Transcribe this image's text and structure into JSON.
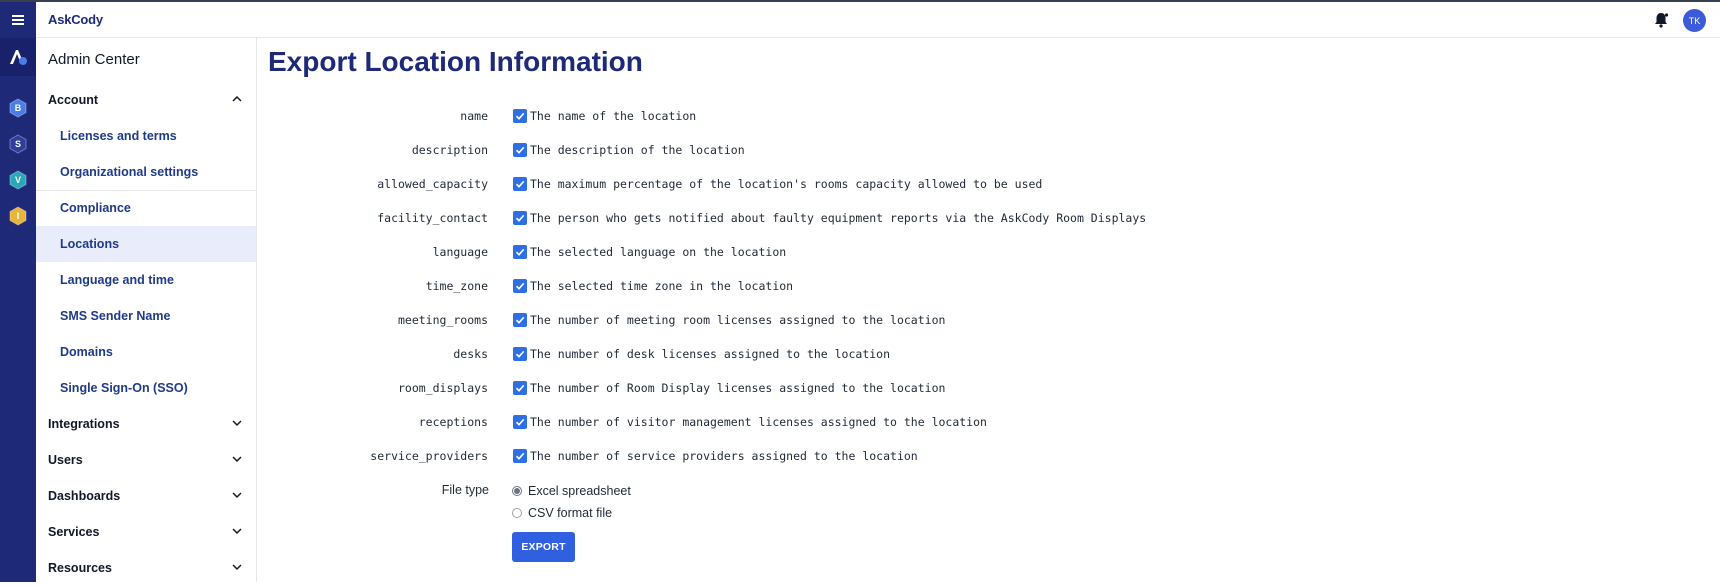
{
  "header": {
    "brand": "AskCody",
    "avatar_initials": "TK",
    "accent": "#1e2a78",
    "button_color": "#3060e0"
  },
  "rail": {
    "icons": [
      {
        "letter": "B",
        "color": "#4a7de8"
      },
      {
        "letter": "S",
        "color": "#2e3e9a"
      },
      {
        "letter": "V",
        "color": "#2aa7b8"
      },
      {
        "letter": "I",
        "color": "#e8b53a"
      }
    ]
  },
  "sidebar": {
    "title": "Admin Center",
    "account": {
      "label": "Account",
      "expanded": true
    },
    "account_items": [
      "Licenses and terms",
      "Organizational settings",
      "Compliance",
      "Locations",
      "Language and time",
      "SMS Sender Name",
      "Domains",
      "Single Sign-On (SSO)"
    ],
    "active_item": "Locations",
    "groups": [
      "Integrations",
      "Users",
      "Dashboards",
      "Services",
      "Resources"
    ]
  },
  "main": {
    "title": "Export Location Information",
    "fields": [
      {
        "name": "name",
        "description": "The name of the location",
        "checked": true
      },
      {
        "name": "description",
        "description": "The description of the location",
        "checked": true
      },
      {
        "name": "allowed_capacity",
        "description": "The maximum percentage of the location's rooms capacity allowed to be used",
        "checked": true
      },
      {
        "name": "facility_contact",
        "description": "The person who gets notified about faulty equipment reports via the AskCody Room Displays",
        "checked": true
      },
      {
        "name": "language",
        "description": "The selected language on the location",
        "checked": true
      },
      {
        "name": "time_zone",
        "description": "The selected time zone in the location",
        "checked": true
      },
      {
        "name": "meeting_rooms",
        "description": "The number of meeting room licenses assigned to the location",
        "checked": true
      },
      {
        "name": "desks",
        "description": "The number of desk licenses assigned to the location",
        "checked": true
      },
      {
        "name": "room_displays",
        "description": "The number of Room Display licenses assigned to the location",
        "checked": true
      },
      {
        "name": "receptions",
        "description": "The number of visitor management licenses assigned to the location",
        "checked": true
      },
      {
        "name": "service_providers",
        "description": "The number of service providers assigned to the location",
        "checked": true
      }
    ],
    "file_type": {
      "label": "File type",
      "options": [
        "Excel spreadsheet",
        "CSV format file"
      ],
      "selected": "Excel spreadsheet"
    },
    "export_label": "EXPORT"
  }
}
